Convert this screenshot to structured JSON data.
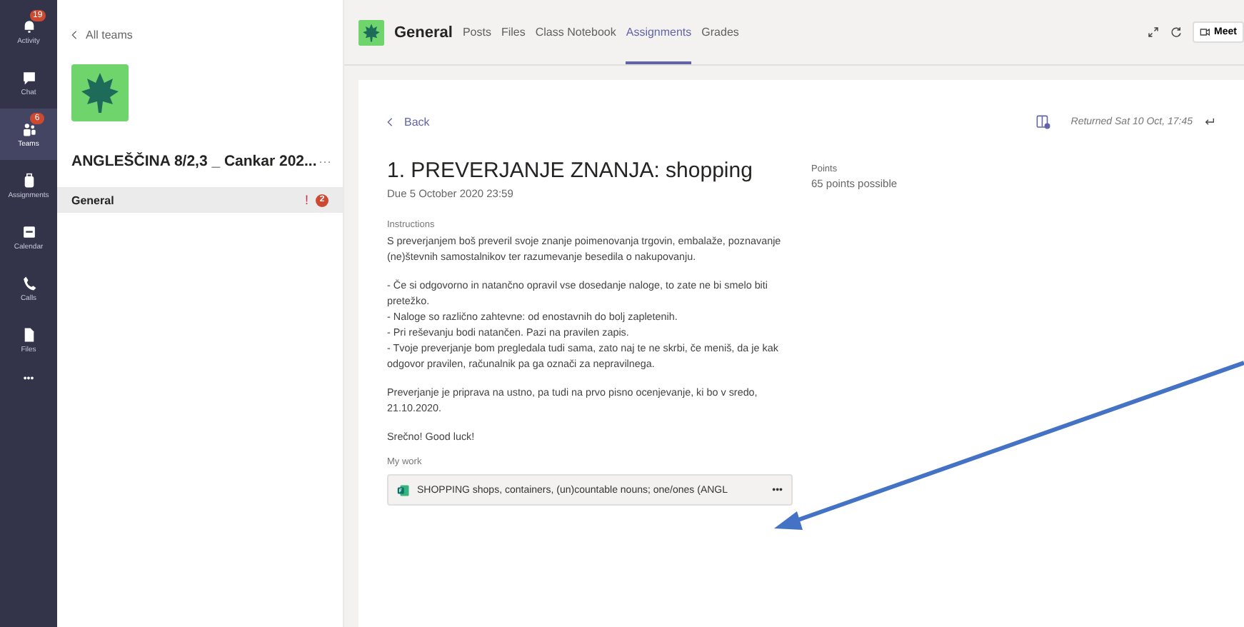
{
  "rail": [
    {
      "label": "Activity",
      "kind": "bell",
      "badge": "19",
      "selected": false
    },
    {
      "label": "Chat",
      "kind": "chat",
      "selected": false
    },
    {
      "label": "Teams",
      "kind": "teams",
      "badge": "6",
      "selected": true
    },
    {
      "label": "Assignments",
      "kind": "bag",
      "selected": false
    },
    {
      "label": "Calendar",
      "kind": "calendar",
      "selected": false
    },
    {
      "label": "Calls",
      "kind": "phone",
      "selected": false
    },
    {
      "label": "Files",
      "kind": "file",
      "selected": false
    }
  ],
  "rail_more": "•••",
  "team_panel": {
    "back": "All teams",
    "team_name": "ANGLEŠČINA 8/2,3 _ Cankar 202...",
    "more": "···",
    "channels": [
      {
        "name": "General",
        "selected": true,
        "alert": "!",
        "badge": "2"
      }
    ]
  },
  "header": {
    "channel": "General",
    "tabs": [
      {
        "label": "Posts",
        "selected": false
      },
      {
        "label": "Files",
        "selected": false
      },
      {
        "label": "Class Notebook",
        "selected": false
      },
      {
        "label": "Assignments",
        "selected": true
      },
      {
        "label": "Grades",
        "selected": false
      }
    ],
    "meet": "Meet"
  },
  "assignment": {
    "back": "Back",
    "returned": "Returned Sat 10 Oct, 17:45",
    "title": "1. PREVERJANJE ZNANJA: shopping",
    "due": "Due 5 October 2020 23:59",
    "points_label": "Points",
    "points": "65 points possible",
    "instructions_label": "Instructions",
    "instructions": [
      "S preverjanjem boš preveril svoje znanje poimenovanja trgovin, embalaže, poznavanje (ne)števnih samostalnikov ter razumevanje besedila o nakupovanju.",
      "- Če si odgovorno in natančno opravil vse dosedanje naloge, to zate ne bi smelo biti pretežko.\n- Naloge so različno zahtevne: od enostavnih do bolj zapletenih.\n- Pri reševanju bodi natančen. Pazi na pravilen zapis.\n- Tvoje preverjanje bom pregledala tudi sama, zato naj te ne skrbi, če meniš, da je kak odgovor pravilen, računalnik pa ga označi za nepravilnega.",
      "Preverjanje je priprava na ustno, pa tudi na prvo pisno ocenjevanje, ki bo v sredo, 21.10.2020.",
      "Srečno! Good luck!"
    ],
    "my_work_label": "My work",
    "work_file": "SHOPPING shops, containers, (un)countable nouns; one/ones (ANGL",
    "work_more": "•••"
  }
}
